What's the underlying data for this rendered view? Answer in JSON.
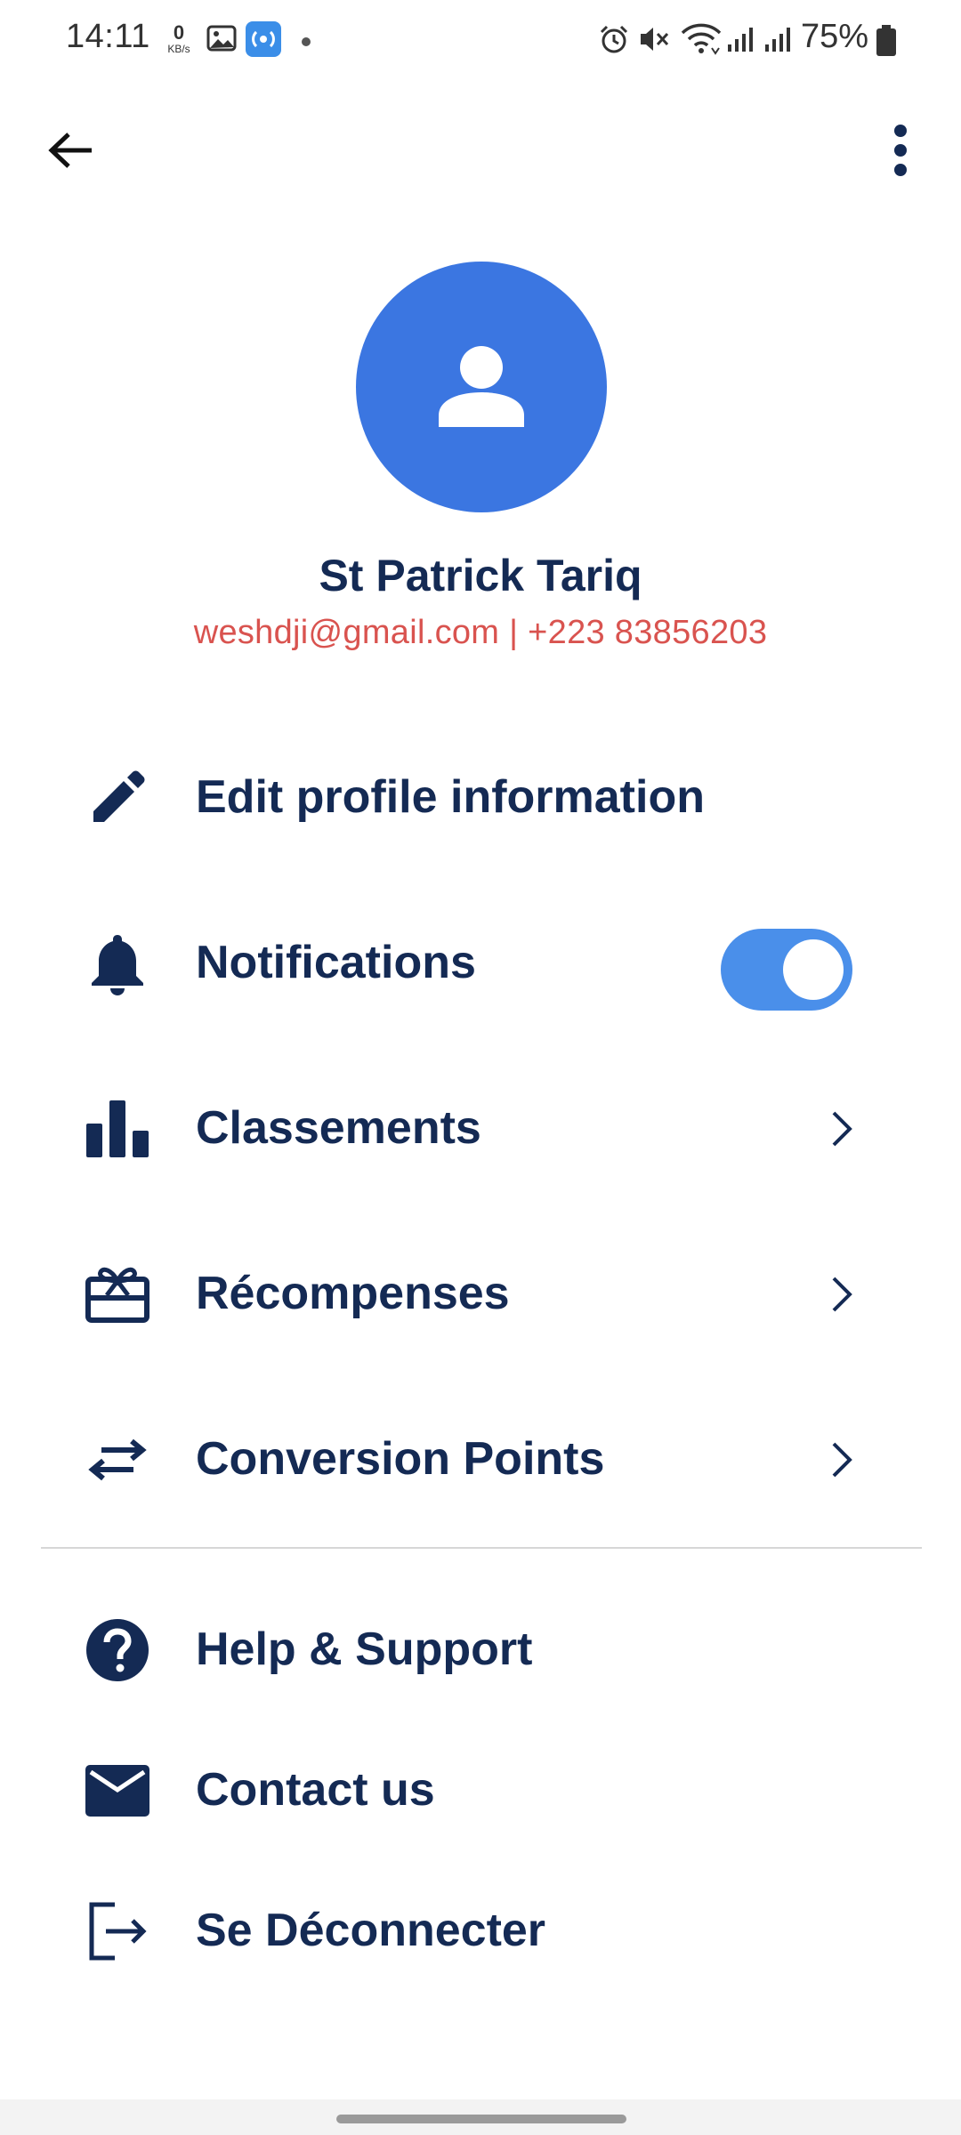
{
  "status_bar": {
    "time": "14:11",
    "net_speed_value": "0",
    "net_speed_unit": "KB/s",
    "battery": "75%"
  },
  "app_bar": {
    "back_icon": "arrow-left-icon",
    "more_icon": "more-vertical-icon"
  },
  "profile": {
    "avatar_icon": "person-icon",
    "name": "St Patrick Tariq",
    "contact": "weshdji@gmail.com | +223 83856203"
  },
  "menu": {
    "items": [
      {
        "id": "edit-profile",
        "icon": "pencil-icon",
        "label": "Edit profile information",
        "trailing": "none"
      },
      {
        "id": "notifications",
        "icon": "bell-icon",
        "label": "Notifications",
        "trailing": "toggle",
        "toggle_on": true
      },
      {
        "id": "classements",
        "icon": "bar-chart-icon",
        "label": "Classements",
        "trailing": "chevron"
      },
      {
        "id": "recompenses",
        "icon": "gift-card-icon",
        "label": "Récompenses",
        "trailing": "chevron"
      },
      {
        "id": "conversion",
        "icon": "swap-arrows-icon",
        "label": "Conversion Points",
        "trailing": "chevron"
      }
    ],
    "secondary_items": [
      {
        "id": "help",
        "icon": "help-circle-icon",
        "label": "Help & Support"
      },
      {
        "id": "contact",
        "icon": "mail-icon",
        "label": "Contact us"
      },
      {
        "id": "logout",
        "icon": "logout-icon",
        "label": "Se Déconnecter"
      }
    ]
  },
  "colors": {
    "primary_text": "#142a54",
    "accent_blue": "#3b76e1",
    "toggle_track": "#4a8fea",
    "contact_red": "#d9534f"
  }
}
